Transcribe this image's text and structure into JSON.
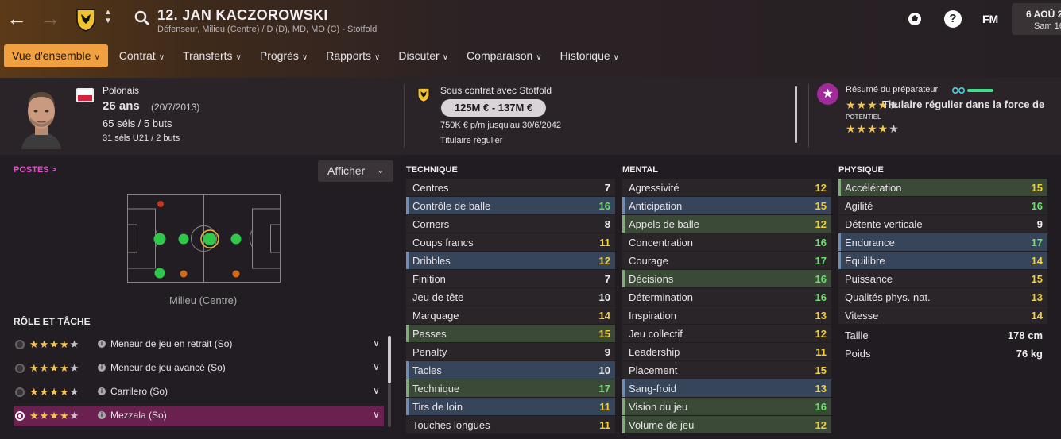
{
  "header": {
    "player_title": "12. JAN KACZOROWSKI",
    "positions": "Défenseur, Milieu (Centre) / D (D), MD, MO (C) - Stotfold",
    "fm_label": "FM",
    "date_line1": "6 AOÛ 2",
    "date_line2": "Sam 16",
    "help_label": "?"
  },
  "tabs": [
    {
      "label": "Vue d'ensemble",
      "active": true
    },
    {
      "label": "Contrat"
    },
    {
      "label": "Transferts"
    },
    {
      "label": "Progrès"
    },
    {
      "label": "Rapports"
    },
    {
      "label": "Discuter"
    },
    {
      "label": "Comparaison"
    },
    {
      "label": "Historique"
    }
  ],
  "profile": {
    "nationality": "Polonais",
    "age": "26 ans",
    "dob": "(20/7/2013)",
    "caps": "65 séls / 5 buts",
    "u21_caps": "31 séls U21 / 2 buts"
  },
  "contract": {
    "club_line": "Sous contrat avec Stotfold",
    "value": "125M € - 137M €",
    "wage": "750K € p/m jusqu'au 30/6/2042",
    "status": "Titulaire régulier"
  },
  "coach": {
    "title": "Résumé du préparateur",
    "ability_stars": 4,
    "summary": "Titulaire régulier dans la force de",
    "potential_label": "POTENTIEL",
    "potential_stars": 4
  },
  "positions_panel": {
    "title": "POSTES >",
    "afficher": "Afficher",
    "pitch_label": "Milieu (Centre)"
  },
  "roles": {
    "title": "RÔLE ET TÂCHE",
    "items": [
      {
        "name": "Meneur de jeu en retrait (So)",
        "stars": 4,
        "selected": false
      },
      {
        "name": "Meneur de jeu avancé (So)",
        "stars": 4,
        "selected": false
      },
      {
        "name": "Carrilero (So)",
        "stars": 4,
        "selected": false
      },
      {
        "name": "Mezzala (So)",
        "stars": 4,
        "selected": true
      }
    ]
  },
  "attributes": {
    "technique": {
      "title": "TECHNIQUE",
      "rows": [
        {
          "name": "Centres",
          "value": "7",
          "hl": ""
        },
        {
          "name": "Contrôle de balle",
          "value": "16",
          "hl": "blue"
        },
        {
          "name": "Corners",
          "value": "8",
          "hl": ""
        },
        {
          "name": "Coups francs",
          "value": "11",
          "hl": ""
        },
        {
          "name": "Dribbles",
          "value": "12",
          "hl": "blue"
        },
        {
          "name": "Finition",
          "value": "7",
          "hl": ""
        },
        {
          "name": "Jeu de tête",
          "value": "10",
          "hl": ""
        },
        {
          "name": "Marquage",
          "value": "14",
          "hl": ""
        },
        {
          "name": "Passes",
          "value": "15",
          "hl": "green"
        },
        {
          "name": "Penalty",
          "value": "9",
          "hl": ""
        },
        {
          "name": "Tacles",
          "value": "10",
          "hl": "blue"
        },
        {
          "name": "Technique",
          "value": "17",
          "hl": "green"
        },
        {
          "name": "Tirs de loin",
          "value": "11",
          "hl": "blue"
        },
        {
          "name": "Touches longues",
          "value": "11",
          "hl": ""
        }
      ]
    },
    "mental": {
      "title": "MENTAL",
      "rows": [
        {
          "name": "Agressivité",
          "value": "12",
          "hl": ""
        },
        {
          "name": "Anticipation",
          "value": "15",
          "hl": "blue"
        },
        {
          "name": "Appels de balle",
          "value": "12",
          "hl": "green"
        },
        {
          "name": "Concentration",
          "value": "16",
          "hl": ""
        },
        {
          "name": "Courage",
          "value": "17",
          "hl": ""
        },
        {
          "name": "Décisions",
          "value": "16",
          "hl": "green"
        },
        {
          "name": "Détermination",
          "value": "16",
          "hl": ""
        },
        {
          "name": "Inspiration",
          "value": "13",
          "hl": ""
        },
        {
          "name": "Jeu collectif",
          "value": "12",
          "hl": ""
        },
        {
          "name": "Leadership",
          "value": "11",
          "hl": ""
        },
        {
          "name": "Placement",
          "value": "15",
          "hl": ""
        },
        {
          "name": "Sang-froid",
          "value": "13",
          "hl": "blue"
        },
        {
          "name": "Vision du jeu",
          "value": "16",
          "hl": "green"
        },
        {
          "name": "Volume de jeu",
          "value": "12",
          "hl": "green"
        }
      ]
    },
    "physique": {
      "title": "PHYSIQUE",
      "rows": [
        {
          "name": "Accélération",
          "value": "15",
          "hl": "green"
        },
        {
          "name": "Agilité",
          "value": "16",
          "hl": ""
        },
        {
          "name": "Détente verticale",
          "value": "9",
          "hl": ""
        },
        {
          "name": "Endurance",
          "value": "17",
          "hl": "blue"
        },
        {
          "name": "Équilibre",
          "value": "14",
          "hl": "blue"
        },
        {
          "name": "Puissance",
          "value": "15",
          "hl": ""
        },
        {
          "name": "Qualités phys. nat.",
          "value": "13",
          "hl": ""
        },
        {
          "name": "Vitesse",
          "value": "14",
          "hl": ""
        }
      ],
      "extra": [
        {
          "name": "Taille",
          "value": "178 cm"
        },
        {
          "name": "Poids",
          "value": "76 kg"
        }
      ]
    }
  }
}
